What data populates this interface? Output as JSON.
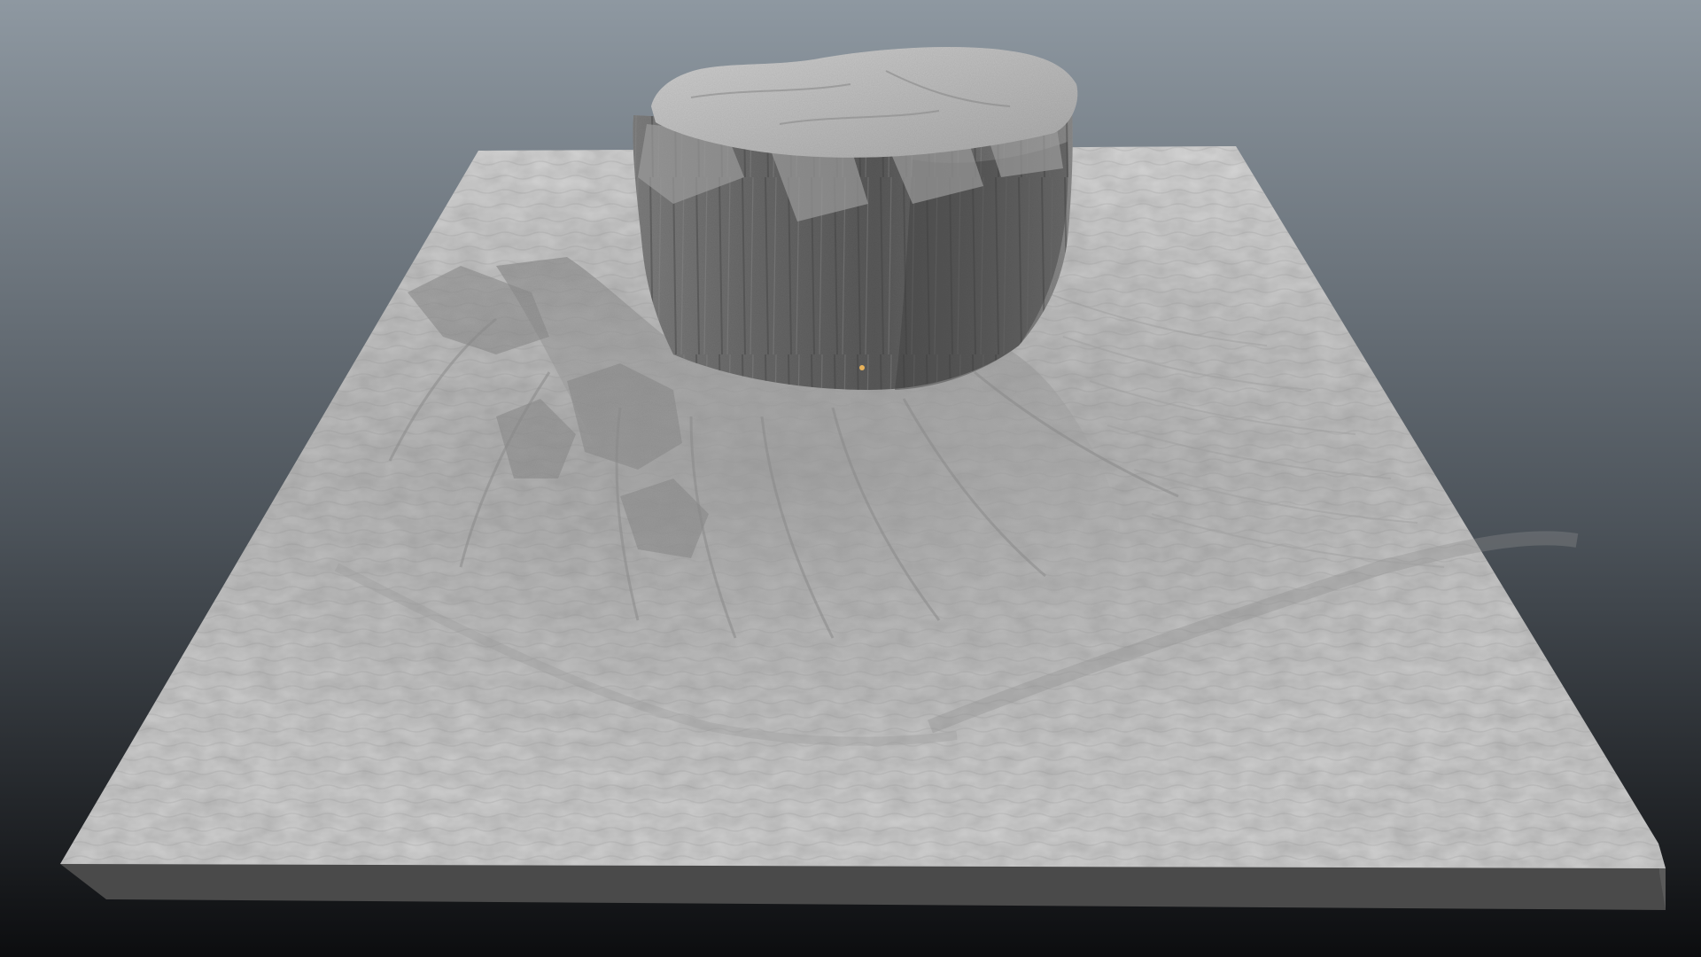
{
  "viewport": {
    "background_top": "#8e98a1",
    "background_mid": "#4c535a",
    "background_bottom": "#0c0d0f"
  },
  "scene": {
    "terrain_color": "#c9c9c9",
    "terrain_shadow": "#6f6f6f",
    "side_front_color": "#4a4a4a",
    "side_right_color": "#5a5a5a",
    "butte_color": "#7a7a7a",
    "butte_dark": "#4f4f4f",
    "butte_top": "#b8b8b8",
    "light_marker_color": "#e8b25a"
  }
}
